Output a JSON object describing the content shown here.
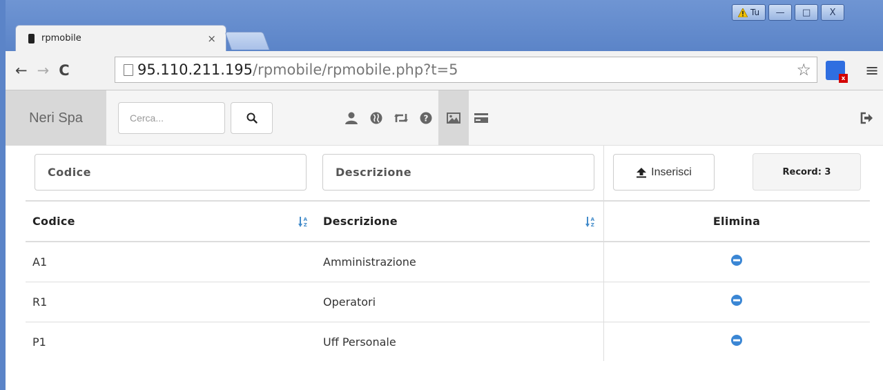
{
  "window": {
    "warning_badge": "Tu",
    "tab_title": "rpmobile",
    "url_host": "95.110.211.195",
    "url_path": "/rpmobile/rpmobile.php?t=5"
  },
  "navbar": {
    "brand": "Neri Spa",
    "search_placeholder": "Cerca...",
    "icons": [
      "user-icon",
      "globe-icon",
      "retweet-icon",
      "question-icon",
      "picture-icon",
      "credit-card-icon"
    ],
    "active_icon": "picture-icon"
  },
  "filters": {
    "codice_placeholder": "Codice",
    "descrizione_placeholder": "Descrizione",
    "insert_label": "Inserisci",
    "record_label": "Record: 3"
  },
  "table": {
    "headers": {
      "codice": "Codice",
      "descrizione": "Descrizione",
      "elimina": "Elimina"
    },
    "rows": [
      {
        "codice": "A1",
        "descrizione": "Amministrazione"
      },
      {
        "codice": "R1",
        "descrizione": "Operatori"
      },
      {
        "codice": "P1",
        "descrizione": "Uff Personale"
      }
    ]
  },
  "colors": {
    "accent": "#428bca",
    "delete_icon": "#3a86d4",
    "brand_bg": "#d8d8d8"
  }
}
